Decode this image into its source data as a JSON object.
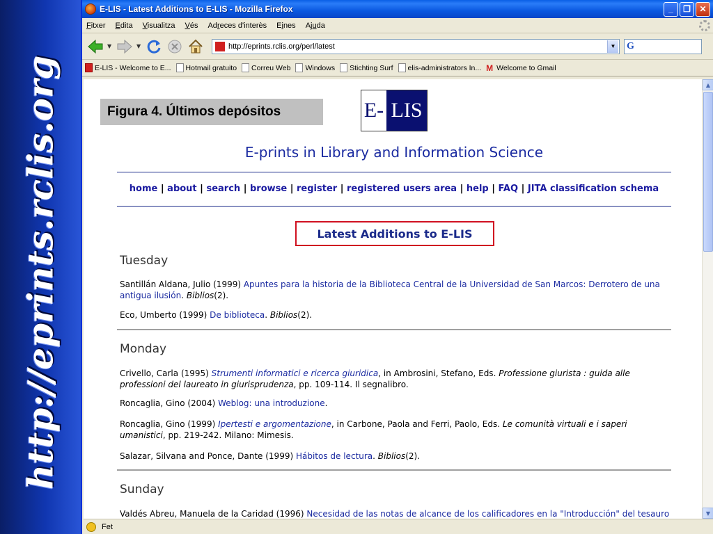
{
  "side_band": {
    "text": "http://eprints.rclis.org"
  },
  "window": {
    "title": "E-LIS - Latest Additions to E-LIS - Mozilla Firefox",
    "controls": {
      "minimize": "_",
      "maximize": "❐",
      "close": "✕"
    }
  },
  "menubar": [
    {
      "ul": "F",
      "rest": "itxer"
    },
    {
      "ul": "E",
      "rest": "dita"
    },
    {
      "ul": "V",
      "rest": "isualitza"
    },
    {
      "ul": "V",
      "rest": "és"
    },
    {
      "pre": "Ad",
      "ul": "r",
      "rest": "eces d'interès"
    },
    {
      "pre": "E",
      "ul": "i",
      "rest": "nes"
    },
    {
      "pre": "Aj",
      "ul": "u",
      "rest": "da"
    }
  ],
  "navbar": {
    "url": "http://eprints.rclis.org/perl/latest",
    "search_placeholder": ""
  },
  "bookmarks": [
    {
      "label": "E-LIS - Welcome to E...",
      "icon": "red"
    },
    {
      "label": "Hotmail gratuito",
      "icon": "page"
    },
    {
      "label": "Correu Web",
      "icon": "page"
    },
    {
      "label": "Windows",
      "icon": "page"
    },
    {
      "label": "Stichting Surf",
      "icon": "page"
    },
    {
      "label": "elis-administrators In...",
      "icon": "page"
    },
    {
      "label": "Welcome to Gmail",
      "icon": "gmail"
    }
  ],
  "caption": "Figura 4. Últimos depósitos",
  "logo": {
    "left": "E-",
    "right": "LIS"
  },
  "page": {
    "site_title": "E-prints in Library and Information Science",
    "nav": [
      "home",
      "about",
      "search",
      "browse",
      "register",
      "registered users area",
      "help",
      "FAQ",
      "JITA classification schema"
    ],
    "heading": "Latest Additions to E-LIS",
    "days": {
      "tuesday": "Tuesday",
      "monday": "Monday",
      "sunday": "Sunday"
    },
    "entries": {
      "e1": {
        "author": "Santillán Aldana, Julio (1999) ",
        "title": "Apuntes para la historia de la Biblioteca Central de la Universidad de San Marcos: Derrotero de una antigua ilusión",
        "dot": ". ",
        "journal": "Biblios",
        "issue": "(2)."
      },
      "e2": {
        "author": "Eco, Umberto (1999) ",
        "title": "De biblioteca",
        "dot": ". ",
        "journal": "Biblios",
        "issue": "(2)."
      },
      "e3": {
        "author": "Crivello, Carla (1995) ",
        "title": "Strumenti informatici e ricerca giuridica",
        "mid": ", in Ambrosini, Stefano, Eds. ",
        "book": "Professione giurista : guida alle professioni del laureato in giurisprudenza",
        "rest": ", pp. 109-114. Il segnalibro."
      },
      "e4": {
        "author": "Roncaglia, Gino (2004) ",
        "title": "Weblog: una introduzione",
        "rest": "."
      },
      "e5": {
        "author": "Roncaglia, Gino (1999) ",
        "title": "Ipertesti e argomentazione",
        "mid": ", in Carbone, Paola and Ferri, Paolo, Eds. ",
        "book": "Le comunità virtuali e i saperi umanistici",
        "rest": ", pp. 219-242. Milano: Mimesis."
      },
      "e6": {
        "author": "Salazar, Silvana and Ponce, Dante (1999) ",
        "title": "Hábitos de lectura",
        "dot": ". ",
        "journal": "Biblios",
        "issue": "(2)."
      },
      "e7": {
        "author": "Valdés Abreu, Manuela de la Caridad (1996) ",
        "title": "Necesidad de las notas de alcance de los calificadores en la \"Introducción\" del tesauro"
      }
    }
  },
  "status": "Fet"
}
